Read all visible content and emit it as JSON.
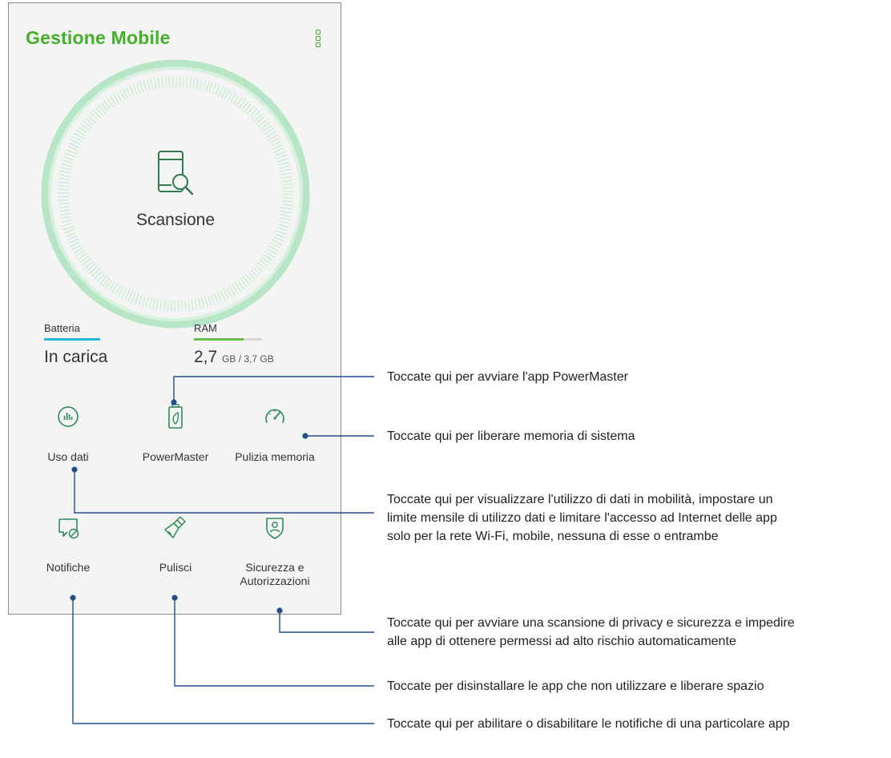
{
  "app": {
    "title": "Gestione Mobile",
    "menu_icon": "more-vert-icon"
  },
  "scan": {
    "label": "Scansione",
    "icon": "phone-search-icon"
  },
  "battery": {
    "label": "Batteria",
    "value": "In carica",
    "level": 1.0,
    "color": "#23b7de"
  },
  "ram": {
    "label": "RAM",
    "used": "2,7",
    "total": "GB / 3,7 GB",
    "fraction": 0.73,
    "color": "#64c04a"
  },
  "tiles": [
    {
      "label": "Uso dati",
      "icon": "data-usage-icon"
    },
    {
      "label": "PowerMaster",
      "icon": "battery-leaf-icon"
    },
    {
      "label": "Pulizia memoria",
      "icon": "speedometer-icon"
    },
    {
      "label": "Notifiche",
      "icon": "notification-block-icon"
    },
    {
      "label": "Pulisci",
      "icon": "brush-icon"
    },
    {
      "label": "Sicurezza e Autorizzazioni",
      "label_line1": "Sicurezza e",
      "label_line2": "Autorizzazioni",
      "icon": "shield-user-icon"
    }
  ],
  "callouts": {
    "powermaster": "Toccate qui per avviare l'app PowerMaster",
    "memory": "Toccate qui per liberare memoria di sistema",
    "data": [
      "Toccate qui per visualizzare l'utilizzo di dati in mobilità, impostare un",
      "limite mensile di utilizzo dati e limitare l'accesso ad Internet delle app",
      "solo per la rete Wi-Fi, mobile, nessuna di esse o entrambe"
    ],
    "security": [
      "Toccate qui per avviare una scansione di privacy e sicurezza e impedire",
      "alle app di ottenere permessi ad alto rischio automaticamente"
    ],
    "clean": "Toccate per disinstallare le app che non utilizzare e liberare spazio",
    "notifications": "Toccate qui per abilitare o disabilitare le notifiche di una particolare app"
  },
  "colors": {
    "brand_green": "#43b02a",
    "ring_green": "#a6e0b8",
    "icon_green": "#2f8a5a",
    "callout_line": "#1f4f8f"
  }
}
